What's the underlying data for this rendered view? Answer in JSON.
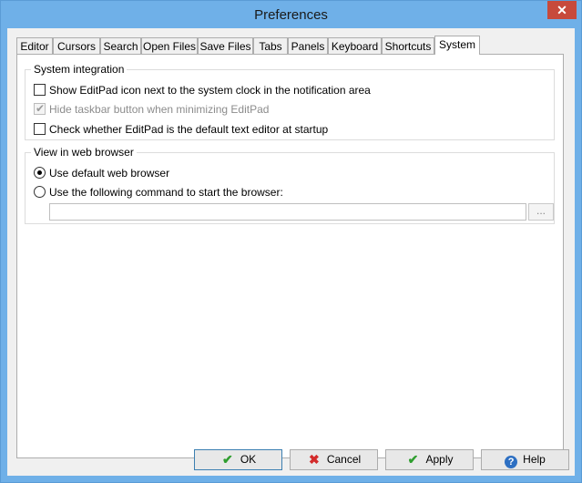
{
  "window": {
    "title": "Preferences",
    "close_glyph": "✕"
  },
  "tabs": [
    {
      "label": "Editor",
      "active": false
    },
    {
      "label": "Cursors",
      "active": false
    },
    {
      "label": "Search",
      "active": false
    },
    {
      "label": "Open Files",
      "active": false
    },
    {
      "label": "Save Files",
      "active": false
    },
    {
      "label": "Tabs",
      "active": false
    },
    {
      "label": "Panels",
      "active": false
    },
    {
      "label": "Keyboard",
      "active": false
    },
    {
      "label": "Shortcuts",
      "active": false
    },
    {
      "label": "System",
      "active": true
    }
  ],
  "system_integration": {
    "title": "System integration",
    "options": [
      {
        "label": "Show EditPad icon next to the system clock in the notification area",
        "checked": false,
        "enabled": true
      },
      {
        "label": "Hide taskbar button when minimizing EditPad",
        "checked": true,
        "enabled": false
      },
      {
        "label": "Check whether EditPad is the default text editor at startup",
        "checked": false,
        "enabled": true
      }
    ]
  },
  "web_browser": {
    "title": "View in web browser",
    "options": [
      {
        "label": "Use default web browser",
        "selected": true
      },
      {
        "label": "Use the following command to start the browser:",
        "selected": false
      }
    ],
    "command_value": "",
    "browse_label": "..."
  },
  "footer": {
    "ok_label": "OK",
    "cancel_label": "Cancel",
    "apply_label": "Apply",
    "help_label": "Help",
    "ok_icon": "✔",
    "cancel_icon": "✖",
    "apply_icon": "✔",
    "help_icon": "?"
  }
}
